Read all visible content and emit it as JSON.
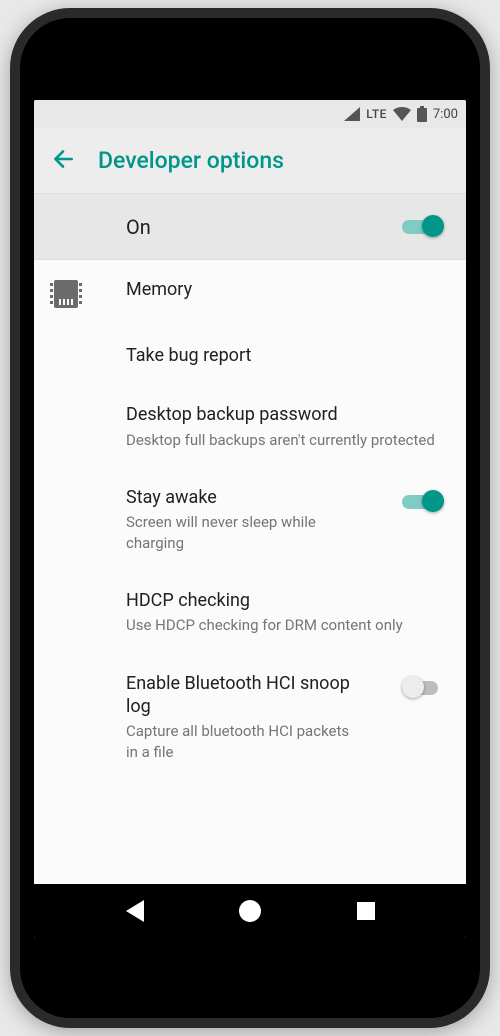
{
  "status": {
    "network": "LTE",
    "clock": "7:00"
  },
  "header": {
    "title": "Developer options"
  },
  "master": {
    "label": "On",
    "enabled": true
  },
  "items": [
    {
      "id": "memory",
      "title": "Memory",
      "sub": null,
      "icon": "memory-chip",
      "toggle": null
    },
    {
      "id": "bugreport",
      "title": "Take bug report",
      "sub": null,
      "icon": null,
      "toggle": null
    },
    {
      "id": "backup-pwd",
      "title": "Desktop backup password",
      "sub": "Desktop full backups aren't currently protected",
      "icon": null,
      "toggle": null
    },
    {
      "id": "stay-awake",
      "title": "Stay awake",
      "sub": "Screen will never sleep while charging",
      "icon": null,
      "toggle": true
    },
    {
      "id": "hdcp",
      "title": "HDCP checking",
      "sub": "Use HDCP checking for DRM content only",
      "icon": null,
      "toggle": null
    },
    {
      "id": "bt-hci",
      "title": "Enable Bluetooth HCI snoop log",
      "sub": "Capture all bluetooth HCI packets in a file",
      "icon": null,
      "toggle": false
    }
  ],
  "colors": {
    "accent": "#009688",
    "accentLight": "#80cbc4",
    "textPrimary": "#212121",
    "textSecondary": "#757575"
  }
}
